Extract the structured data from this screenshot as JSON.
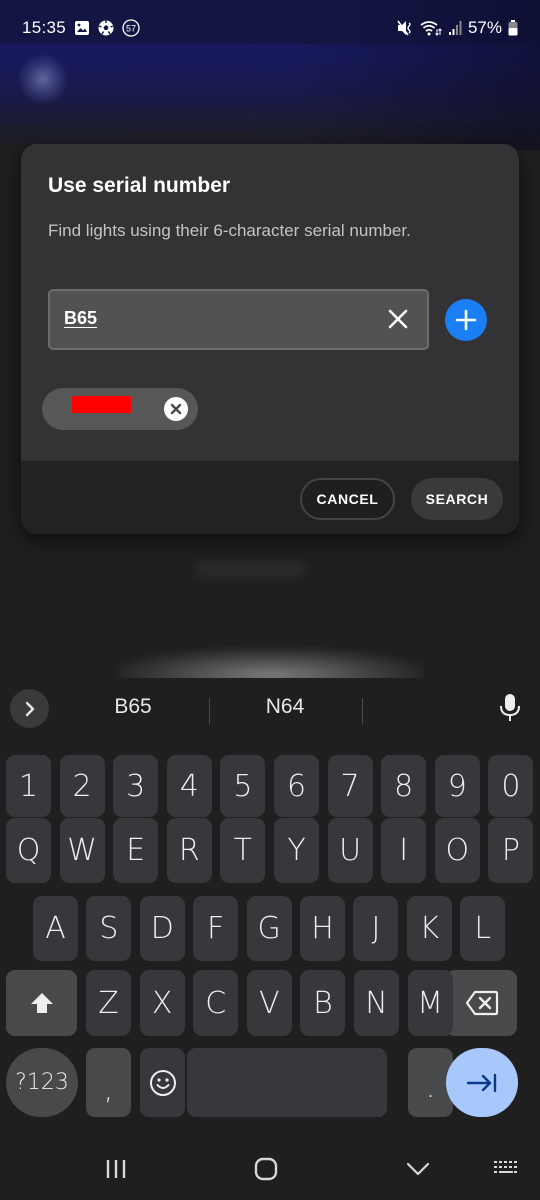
{
  "status_bar": {
    "time": "15:35",
    "notification_icons": [
      "gallery-icon",
      "soccer-ball-icon",
      "badge-57-icon"
    ],
    "badge_count": "57",
    "system_icons": [
      "vibrate-mute-icon",
      "wifi-icon",
      "signal-icon",
      "battery-icon"
    ],
    "battery_percent": "57%"
  },
  "dialog": {
    "title": "Use serial number",
    "description": "Find lights using their 6-character serial number.",
    "serial_input": {
      "value": "B65",
      "placeholder": ""
    },
    "clear_icon": "close-icon",
    "add_icon": "plus-icon",
    "chips": [
      {
        "label": "[redacted]",
        "remove_icon": "close-icon"
      }
    ],
    "cancel_label": "CANCEL",
    "search_label": "SEARCH",
    "colors": {
      "accent": "#1a7ff5",
      "redaction": "#ff0000"
    }
  },
  "keyboard": {
    "suggestions": [
      "B65",
      "N64"
    ],
    "expand_icon": "chevron-right-icon",
    "mic_icon": "microphone-icon",
    "rows": {
      "numbers": [
        "1",
        "2",
        "3",
        "4",
        "5",
        "6",
        "7",
        "8",
        "9",
        "0"
      ],
      "top": [
        "Q",
        "W",
        "E",
        "R",
        "T",
        "Y",
        "U",
        "I",
        "O",
        "P"
      ],
      "middle": [
        "A",
        "S",
        "D",
        "F",
        "G",
        "H",
        "J",
        "K",
        "L"
      ],
      "bottom": [
        "Z",
        "X",
        "C",
        "V",
        "B",
        "N",
        "M"
      ]
    },
    "shift_icon": "shift-arrow-icon",
    "backspace_icon": "backspace-icon",
    "symbols_label": "?123",
    "comma": ",",
    "emoji_icon": "emoji-icon",
    "period": ".",
    "enter_icon": "tab-next-icon",
    "enter_color": "#a8c7fa"
  },
  "navbar": {
    "buttons": [
      "recent-apps-icon",
      "home-icon",
      "hide-keyboard-icon",
      "keyboard-switch-icon"
    ]
  }
}
